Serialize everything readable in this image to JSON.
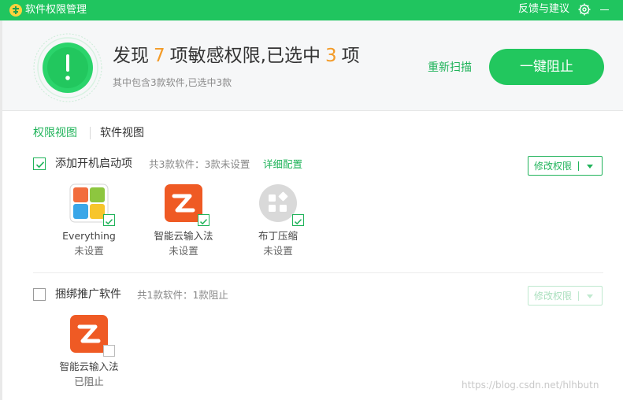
{
  "window": {
    "title": "软件权限管理",
    "feedback": "反馈与建议"
  },
  "header": {
    "headline_prefix": "发现",
    "found_count": "7",
    "headline_middle": "项敏感权限,已选中",
    "selected_count": "3",
    "headline_suffix": "项",
    "subline": "其中包含3款软件,已选中3款",
    "rescan_label": "重新扫描",
    "block_label": "一键阻止"
  },
  "tabs": [
    {
      "label": "权限视图",
      "active": true
    },
    {
      "label": "软件视图",
      "active": false
    }
  ],
  "sections": [
    {
      "title": "添加开机启动项",
      "meta": "共3款软件：3款未设置",
      "detail_link": "详细配置",
      "modify_label": "修改权限",
      "checked": true,
      "apps": [
        {
          "name": "Everything",
          "status": "未设置",
          "icon": "everything-icon",
          "checked": true
        },
        {
          "name": "智能云输入法",
          "status": "未设置",
          "icon": "smart-cloud-ime-icon",
          "checked": true
        },
        {
          "name": "布丁压缩",
          "status": "未设置",
          "icon": "puding-compress-icon",
          "checked": true
        }
      ]
    },
    {
      "title": "捆绑推广软件",
      "meta": "共1款软件：1款阻止",
      "modify_label": "修改权限",
      "checked": false,
      "apps": [
        {
          "name": "智能云输入法",
          "status": "已阻止",
          "icon": "smart-cloud-ime-icon",
          "checked": false
        }
      ]
    }
  ],
  "watermark": "https://blog.csdn.net/hlhbutn",
  "colors": {
    "brand_green": "#20c55f",
    "accent_orange": "#f39b28",
    "link_green": "#20b35a"
  }
}
